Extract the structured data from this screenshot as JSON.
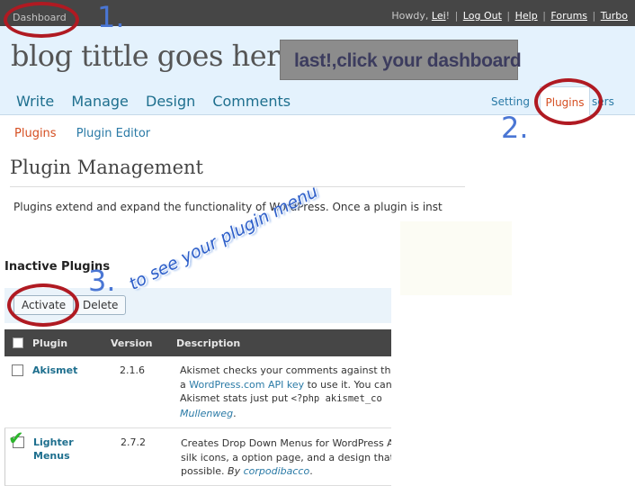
{
  "topbar": {
    "dashboard_label": "Dashboard",
    "howdy_prefix": "Howdy,",
    "user": "Lei",
    "howdy_suffix": "!",
    "links": [
      "Log Out",
      "Help",
      "Forums",
      "Turbo"
    ]
  },
  "header": {
    "blog_title": "blog tittle goes here",
    "main_nav": [
      "Write",
      "Manage",
      "Design",
      "Comments"
    ],
    "right_nav": [
      "Settings",
      "Plugins",
      "Users"
    ],
    "right_nav_visible": [
      "Setting",
      "Plugins",
      "sers"
    ]
  },
  "callout": "last!,click your dashboard",
  "subnav": {
    "active": "Plugins",
    "other": "Plugin Editor"
  },
  "page": {
    "title": "Plugin Management",
    "intro": "Plugins extend and expand the functionality of WordPress. Once a plugin is inst"
  },
  "inactive": {
    "heading": "Inactive Plugins",
    "activate_label": "Activate",
    "delete_label": "Delete"
  },
  "table": {
    "headers": [
      "Plugin",
      "Version",
      "Description"
    ],
    "rows": [
      {
        "name": "Akismet",
        "version": "2.1.6",
        "desc_line1": "Akismet checks your comments against the",
        "desc_line2_pre": "a ",
        "desc_line2_link": "WordPress.com API key",
        "desc_line2_post": " to use it. You can r",
        "desc_line3_pre": "Akismet stats just put ",
        "desc_line3_code": "<?php akismet_co",
        "desc_line4_author": "Mullenweg",
        "desc_line4_post": "."
      },
      {
        "name": "Lighter Menus",
        "version": "2.7.2",
        "desc_line1": "Creates Drop Down Menus for WordPress Ad",
        "desc_line2": "silk icons, a option page, and a design that f",
        "desc_line3_pre": "possible. ",
        "desc_line3_by": "By",
        "desc_line3_author": "corpodibacco",
        "desc_line3_post": "."
      }
    ]
  },
  "annotations": {
    "step1": "1.",
    "step2": "2.",
    "step3": "3.",
    "note": "to see your plugin menu",
    "ring_color": "#b01a22",
    "number_color": "#4a76d4"
  },
  "icons": [
    "checkbox-icon",
    "checkmark-icon"
  ]
}
